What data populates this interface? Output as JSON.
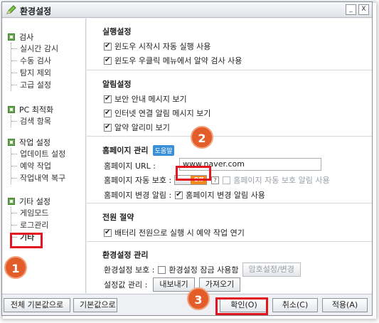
{
  "window": {
    "title": "환경설정",
    "minimize_label": "_",
    "close_label": "X"
  },
  "sidebar": {
    "groups": [
      {
        "label": "검사",
        "items": [
          "실시간 감시",
          "수동 검사",
          "탐지 제외",
          "고급 설정"
        ]
      },
      {
        "label": "PC 최적화",
        "items": [
          "검색 항목"
        ]
      },
      {
        "label": "작업 설정",
        "items": [
          "업데이트 설정",
          "예약 작업",
          "작업내역 복구"
        ]
      },
      {
        "label": "기타 설정",
        "items": [
          "게임모드",
          "로그관리",
          "기타"
        ]
      }
    ],
    "active_item": "기타"
  },
  "sections": {
    "run": {
      "title": "실행설정",
      "options": [
        {
          "label": "윈도우 시작시 자동 실행 사용",
          "checked": true
        },
        {
          "label": "윈도우 우클릭 메뉴에서 알약 검사 사용",
          "checked": true
        }
      ]
    },
    "alert": {
      "title": "알림설정",
      "options": [
        {
          "label": "보안 안내 메시지 보기",
          "checked": true
        },
        {
          "label": "인터넷 연결 알림 메시지 보기",
          "checked": true
        },
        {
          "label": "알약 알리미 보기",
          "checked": true
        }
      ]
    },
    "homepage": {
      "title": "홈페이지 관리",
      "help_badge": "도움말",
      "url_label": "홈페이지 URL :",
      "url_value": "www.naver.com",
      "protect_label": "홈페이지 자동 보호 :",
      "toggle_state": "Off",
      "help_icon": "?",
      "protect_alert_label": "홈페이지 자동 보호 알림 사용",
      "change_alert_label": "홈페이지 변경 알림 :",
      "change_alert_option": "홈페이지 변경 알림 사용"
    },
    "power": {
      "title": "전원 절약",
      "option": "배터리 전원으로 실행 시 예약 작업 연기"
    },
    "env": {
      "title": "환경설정 관리",
      "protect_label": "환경설정 보호 :",
      "lock_option": "환경설정 잠금 사용함",
      "password_button": "암호설정/변경",
      "manage_label": "설정값 관리 :",
      "export_button": "내보내기",
      "import_button": "가져오기"
    }
  },
  "footer": {
    "reset_all": "전체 기본값으로",
    "reset": "기본값으로",
    "ok": "확인(O)",
    "cancel": "취소(C)",
    "apply": "적용(A)"
  },
  "annotations": {
    "badge1": "1",
    "badge2": "2",
    "badge3": "3"
  },
  "colors": {
    "highlight": "#e3151f",
    "badge": "#e35d2a",
    "toggle_off": "#f28b1f",
    "help_badge": "#3a8fd9",
    "tree_icon": "#6aa84f"
  }
}
